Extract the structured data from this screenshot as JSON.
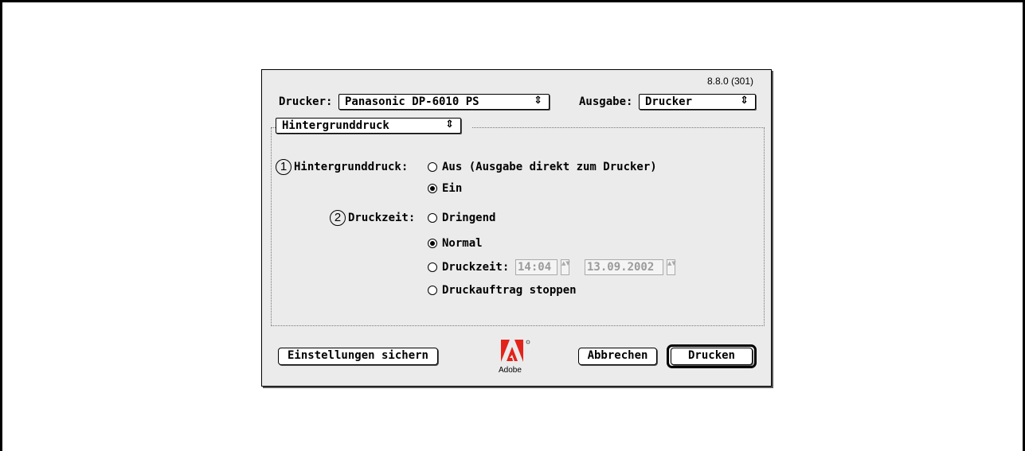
{
  "dialog": {
    "version": "8.8.0 (301)",
    "printer_label": "Drucker:",
    "printer_value": "Panasonic DP-6010 PS",
    "output_label": "Ausgabe:",
    "output_value": "Drucker",
    "panel_value": "Hintergrunddruck",
    "background_print": {
      "marker": "1",
      "label": "Hintergrunddruck:",
      "options": [
        {
          "label": "Aus (Ausgabe direkt zum Drucker)",
          "selected": false
        },
        {
          "label": "Ein",
          "selected": true
        }
      ]
    },
    "print_time": {
      "marker": "2",
      "label": "Druckzeit:",
      "options": [
        {
          "label": "Dringend",
          "selected": false
        },
        {
          "label": "Normal",
          "selected": true
        },
        {
          "label": "Druckzeit:",
          "selected": false
        },
        {
          "label": "Druckauftrag stoppen",
          "selected": false
        }
      ],
      "time_value": "14:04",
      "date_value": "13.09.2002"
    },
    "buttons": {
      "save_settings": "Einstellungen sichern",
      "cancel": "Abbrechen",
      "print": "Drucken"
    },
    "logo_text": "Adobe",
    "popup_arrow": "⇕",
    "stepper_arrows": "▲▼"
  }
}
